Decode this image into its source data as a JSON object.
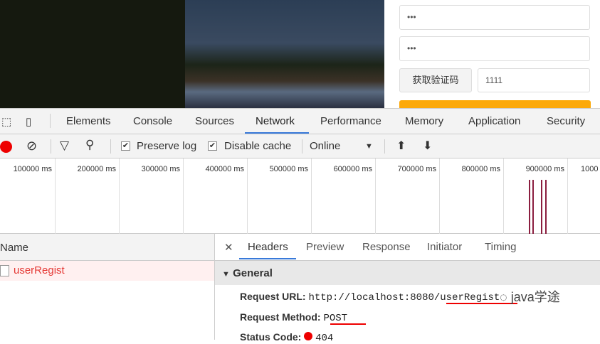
{
  "form": {
    "password1": "•••",
    "password2": "•••",
    "get_code_button": "获取验证码",
    "code_value": "1111"
  },
  "devtools": {
    "tabs": [
      "Elements",
      "Console",
      "Sources",
      "Network",
      "Performance",
      "Memory",
      "Application",
      "Security"
    ],
    "active_tab": "Network",
    "toolbar": {
      "preserve_log": "Preserve log",
      "preserve_log_checked": true,
      "disable_cache": "Disable cache",
      "disable_cache_checked": true,
      "throttle": "Online"
    },
    "timeline_ticks": [
      "100000 ms",
      "200000 ms",
      "300000 ms",
      "400000 ms",
      "500000 ms",
      "600000 ms",
      "700000 ms",
      "800000 ms",
      "900000 ms",
      "1000"
    ],
    "name_header": "Name",
    "requests": [
      {
        "name": "userRegist",
        "status_color": "#e53935"
      }
    ],
    "detail_tabs": [
      "Headers",
      "Preview",
      "Response",
      "Initiator",
      "Timing"
    ],
    "active_detail_tab": "Headers",
    "general": {
      "title": "General",
      "request_url_label": "Request URL:",
      "request_url": "http://localhost:8080/userRegist",
      "method_label": "Request Method:",
      "method": "POST",
      "status_label": "Status Code:",
      "status": "404",
      "status_color": "#e00000"
    }
  },
  "watermark": "java学途"
}
